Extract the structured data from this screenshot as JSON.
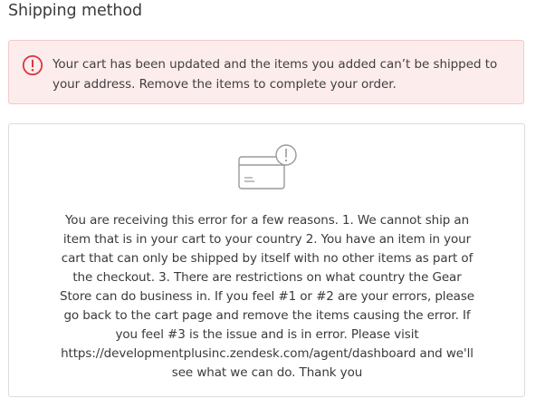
{
  "section": {
    "title": "Shipping method"
  },
  "alert": {
    "icon": "exclamation-circle-icon",
    "message": "Your cart has been updated and the items you added can’t be shipped to your address. Remove the items to complete your order.",
    "colors": {
      "background": "#fdecec",
      "border": "#f5c9ca",
      "icon": "#d9363e"
    }
  },
  "info_card": {
    "icon": "package-warning-icon",
    "message": "You are receiving this error for a few reasons. 1. We cannot ship an item that is in your cart to your country 2. You have an item in your cart that can only be shipped by itself with no other items as part of the checkout. 3. There are restrictions on what country the Gear Store can do business in. If you feel #1 or #2 are your errors, please go back to the cart page and remove the items causing the error. If you feel #3 is the issue and is in error. Please visit https://developmentplusinc.zendesk.com/agent/dashboard and we'll see what we can do. Thank you"
  }
}
